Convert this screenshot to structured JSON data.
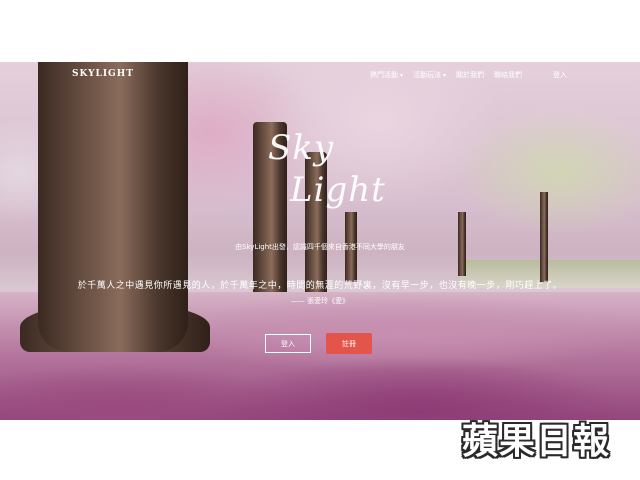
{
  "nav": {
    "logo": "SKYLIGHT",
    "items": [
      {
        "label": "熱門活動",
        "has_dropdown": true
      },
      {
        "label": "活動玩法",
        "has_dropdown": true
      },
      {
        "label": "關於我們",
        "has_dropdown": false
      },
      {
        "label": "聯絡我們",
        "has_dropdown": false
      }
    ],
    "login_label": "登入"
  },
  "hero": {
    "brand_line1": "Sky",
    "brand_line2": "Light",
    "tagline": "由SkyLight出發，認識四千個來自香港不同大學的朋友",
    "quote": "於千萬人之中遇見你所遇見的人，於千萬年之中，時間的無涯的荒野裏，沒有早一步，也沒有晚一步，剛巧趕上了。",
    "attribution": "—— 張愛玲《愛》",
    "login_button": "登入",
    "register_button": "註冊",
    "accent_color": "#e3544b"
  },
  "watermark": "蘋果日報"
}
